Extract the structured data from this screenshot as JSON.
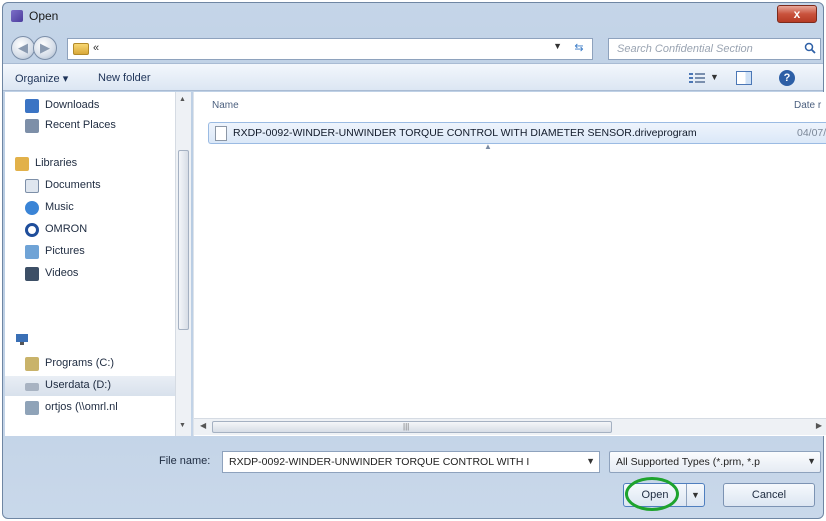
{
  "window": {
    "title": "Open",
    "close_glyph": "x"
  },
  "address": {
    "chevron": "«",
    "search_placeholder": "Search Confidential Section"
  },
  "toolbar": {
    "organize_label": "Organize ▾",
    "new_folder_label": "New folder"
  },
  "sidebar": {
    "items": [
      {
        "label": "Downloads",
        "icon": "downloads-icon",
        "color": "#3b74c4"
      },
      {
        "label": "Recent Places",
        "icon": "recent-places-icon",
        "color": "#7d8fa8"
      },
      {
        "label": "Libraries",
        "icon": "libraries-icon",
        "color": "#e2b14a"
      },
      {
        "label": "Documents",
        "icon": "documents-icon",
        "color": "#dfe6ef"
      },
      {
        "label": "Music",
        "icon": "music-icon",
        "color": "#3a84d6"
      },
      {
        "label": "OMRON",
        "icon": "omron-icon",
        "color": "#1f4e9b"
      },
      {
        "label": "Pictures",
        "icon": "pictures-icon",
        "color": "#6fa3d6"
      },
      {
        "label": "Videos",
        "icon": "videos-icon",
        "color": "#3d4f66"
      },
      {
        "label": "Programs (C:)",
        "icon": "drive-c-icon",
        "color": "#c9b36a"
      },
      {
        "label": "Userdata (D:)",
        "icon": "drive-d-icon",
        "color": "#a8b3c2"
      },
      {
        "label": "ortjos (\\\\omrl.nl",
        "icon": "network-drive-icon",
        "color": "#8fa3b8"
      }
    ]
  },
  "files": {
    "column_name": "Name",
    "column_date": "Date r",
    "rows": [
      {
        "name": "RXDP-0092-WINDER-UNWINDER TORQUE CONTROL WITH DIAMETER SENSOR.driveprogram",
        "date": "04/07/"
      }
    ]
  },
  "bottom": {
    "file_name_label": "File name:",
    "file_name_value": "RXDP-0092-WINDER-UNWINDER TORQUE CONTROL WITH I",
    "file_type_value": "All Supported Types (*.prm, *.p",
    "open_label": "Open",
    "cancel_label": "Cancel"
  },
  "colors": {
    "highlight_ring": "#1ea32d",
    "selection": "#dbe8f8"
  }
}
